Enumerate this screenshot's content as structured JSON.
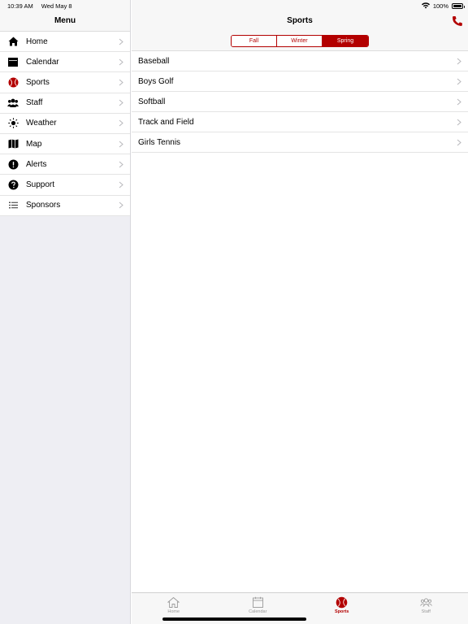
{
  "status": {
    "time": "10:39 AM",
    "date": "Wed May 8",
    "battery": "100%",
    "battery_level": 1.0
  },
  "sidebar": {
    "title": "Menu",
    "items": [
      {
        "label": "Home",
        "icon": "home-icon"
      },
      {
        "label": "Calendar",
        "icon": "calendar-icon"
      },
      {
        "label": "Sports",
        "icon": "sports-ball-icon"
      },
      {
        "label": "Staff",
        "icon": "staff-people-icon"
      },
      {
        "label": "Weather",
        "icon": "sun-icon"
      },
      {
        "label": "Map",
        "icon": "map-icon"
      },
      {
        "label": "Alerts",
        "icon": "alert-icon"
      },
      {
        "label": "Support",
        "icon": "question-icon"
      },
      {
        "label": "Sponsors",
        "icon": "list-icon"
      }
    ]
  },
  "main": {
    "title": "Sports",
    "phone_icon": "phone-icon",
    "segments": {
      "options": [
        "Fall",
        "Winter",
        "Spring"
      ],
      "selected": "Spring"
    },
    "sports": [
      "Baseball",
      "Boys Golf",
      "Softball",
      "Track and Field",
      "Girls Tennis"
    ]
  },
  "tabbar": {
    "tabs": [
      {
        "label": "Home",
        "icon": "home-icon"
      },
      {
        "label": "Calendar",
        "icon": "calendar-icon"
      },
      {
        "label": "Sports",
        "icon": "sports-ball-icon",
        "active": true
      },
      {
        "label": "Staff",
        "icon": "staff-people-icon"
      }
    ]
  },
  "colors": {
    "accent": "#b30000",
    "sidebar_bg": "#eeeef3",
    "bar_bg": "#f7f7f7",
    "separator": "#e4e4e4"
  }
}
